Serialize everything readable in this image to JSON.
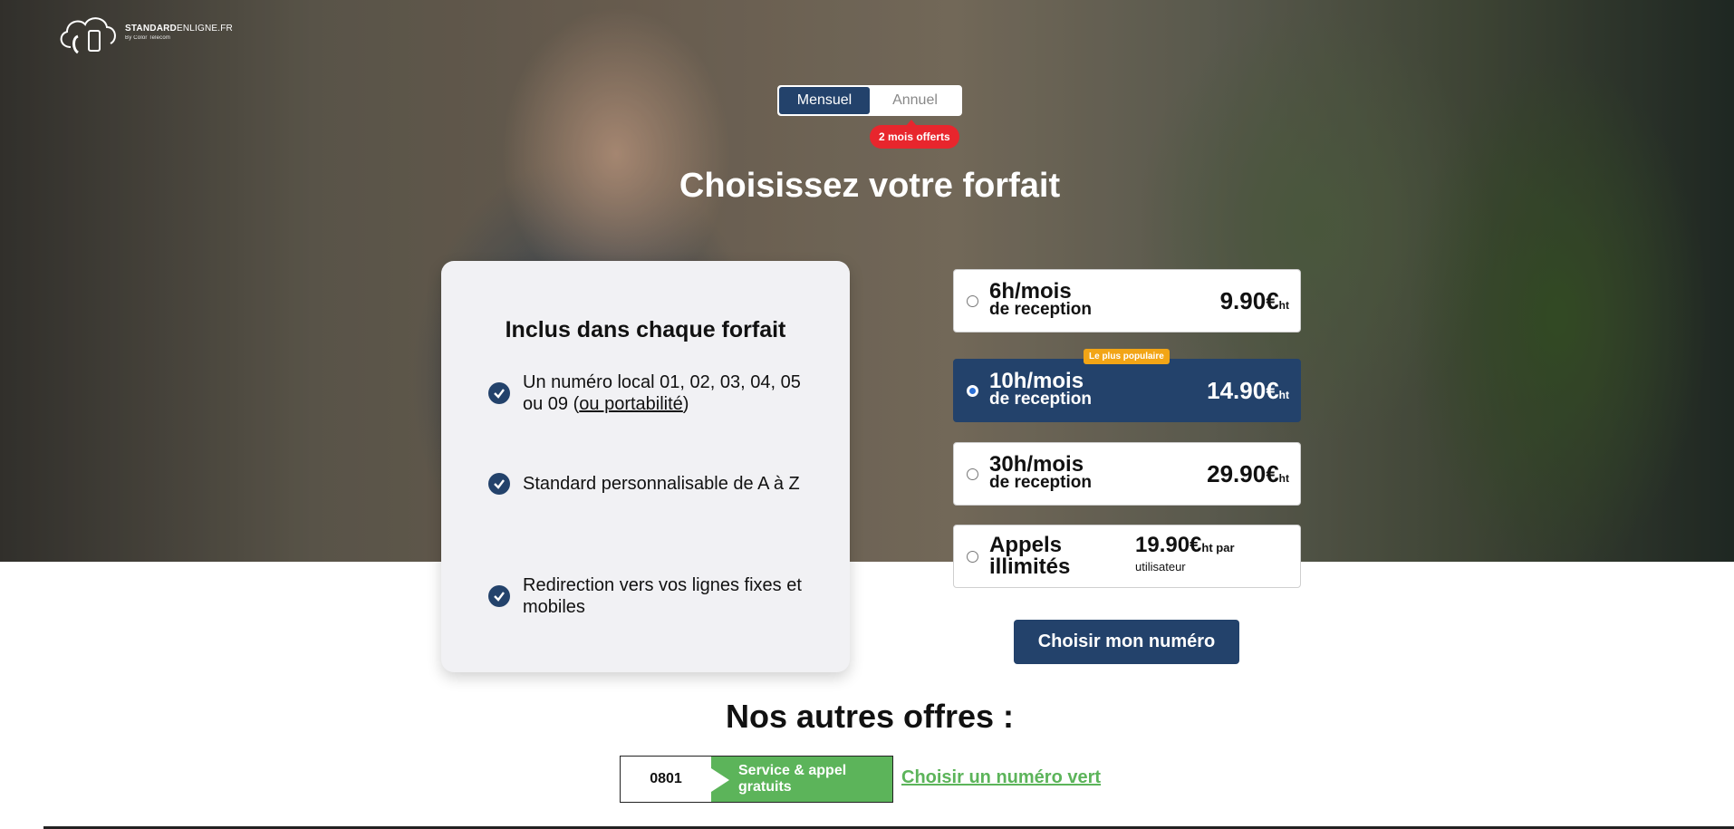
{
  "brand": {
    "name_bold": "STANDARD",
    "name_light": "ENLIGNE.FR",
    "tagline": "By Color Telecom"
  },
  "billing_toggle": {
    "options": [
      "Mensuel",
      "Annuel"
    ],
    "selected": "Mensuel",
    "promo_badge": "2 mois offerts"
  },
  "main": {
    "title": "Choisissez votre forfait"
  },
  "included": {
    "title": "Inclus dans chaque forfait",
    "features": [
      {
        "text": "Un numéro local 01, 02, 03, 04, 05 ou 09 (",
        "link": "ou portabilité",
        "suffix": ")"
      },
      {
        "text": "Standard personnalisable de A à Z"
      },
      {
        "text": "Redirection vers vos lignes fixes et mobiles"
      }
    ]
  },
  "plans": [
    {
      "hours": "6h/mois",
      "subtitle": "de reception",
      "price": "9.90€",
      "unit": "ht",
      "selected": false
    },
    {
      "hours": "10h/mois",
      "subtitle": "de reception",
      "price": "14.90€",
      "unit": "ht",
      "selected": true,
      "badge": "Le plus populaire"
    },
    {
      "hours": "30h/mois",
      "subtitle": "de reception",
      "price": "29.90€",
      "unit": "ht",
      "selected": false
    },
    {
      "hours": "Appels",
      "subtitle": "illimités",
      "price": "19.90€",
      "unit": "ht par",
      "unit_sub": "utilisateur",
      "selected": false
    }
  ],
  "cta": {
    "label": "Choisir mon numéro"
  },
  "other_offers": {
    "title": "Nos autres offres :",
    "number_prefix": "0801",
    "service_label": "Service & appel gratuits",
    "link_label": "Choisir un numéro vert"
  },
  "colors": {
    "primary": "#23426b",
    "promo": "#e8262d",
    "badge": "#f2a516",
    "green": "#5cb45a"
  }
}
